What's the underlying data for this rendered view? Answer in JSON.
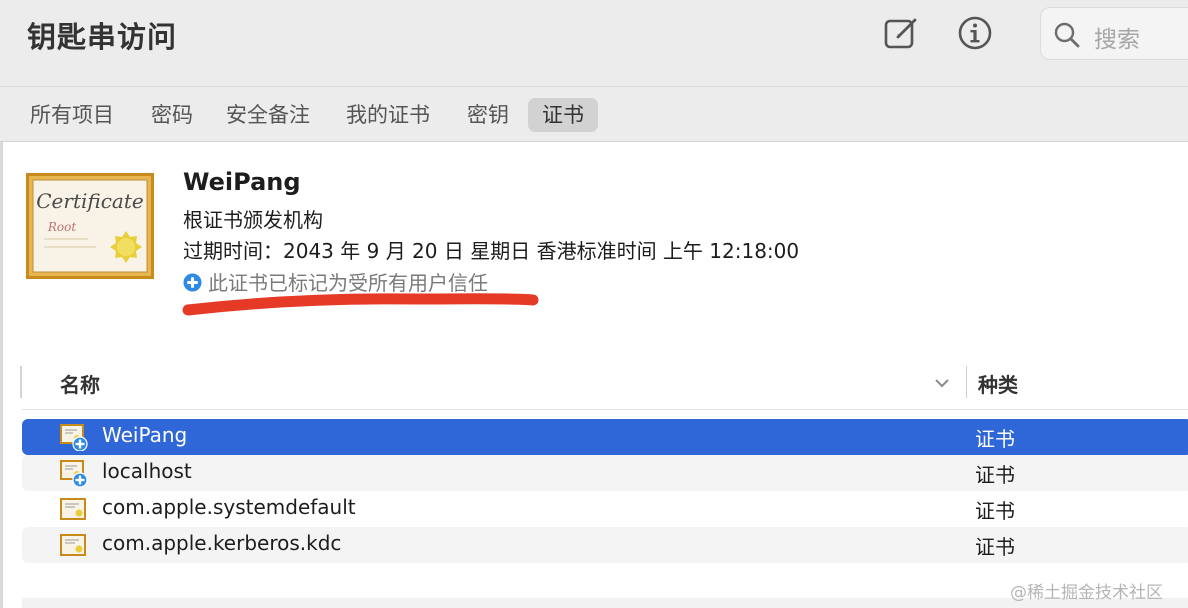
{
  "app": {
    "title": "钥匙串访问"
  },
  "toolbar": {
    "icons": [
      "new-item-icon",
      "info-icon",
      "search-icon"
    ],
    "search_placeholder": "搜索"
  },
  "tabs": [
    {
      "label": "所有项目",
      "active": false
    },
    {
      "label": "密码",
      "active": false
    },
    {
      "label": "安全备注",
      "active": false
    },
    {
      "label": "我的证书",
      "active": false
    },
    {
      "label": "密钥",
      "active": false
    },
    {
      "label": "证书",
      "active": true
    }
  ],
  "detail": {
    "image_text": "Certificate",
    "image_subtext": "Root",
    "name": "WeiPang",
    "type": "根证书颁发机构",
    "expiry": "过期时间：2043 年 9 月 20 日 星期日 香港标准时间 上午 12:18:00",
    "trust": "此证书已标记为受所有用户信任",
    "annotation_color": "#e53a25"
  },
  "table": {
    "columns": [
      "名称",
      "种类"
    ],
    "rows": [
      {
        "name": "WeiPang",
        "kind": "证书",
        "selected": true,
        "trusted_badge": true
      },
      {
        "name": "localhost",
        "kind": "证书",
        "selected": false,
        "trusted_badge": true
      },
      {
        "name": "com.apple.systemdefault",
        "kind": "证书",
        "selected": false,
        "trusted_badge": false
      },
      {
        "name": "com.apple.kerberos.kdc",
        "kind": "证书",
        "selected": false,
        "trusted_badge": false
      }
    ]
  },
  "colors": {
    "accent": "#2f67d8",
    "trust_blue": "#2d8ae6"
  },
  "watermark": "@稀土掘金技术社区"
}
